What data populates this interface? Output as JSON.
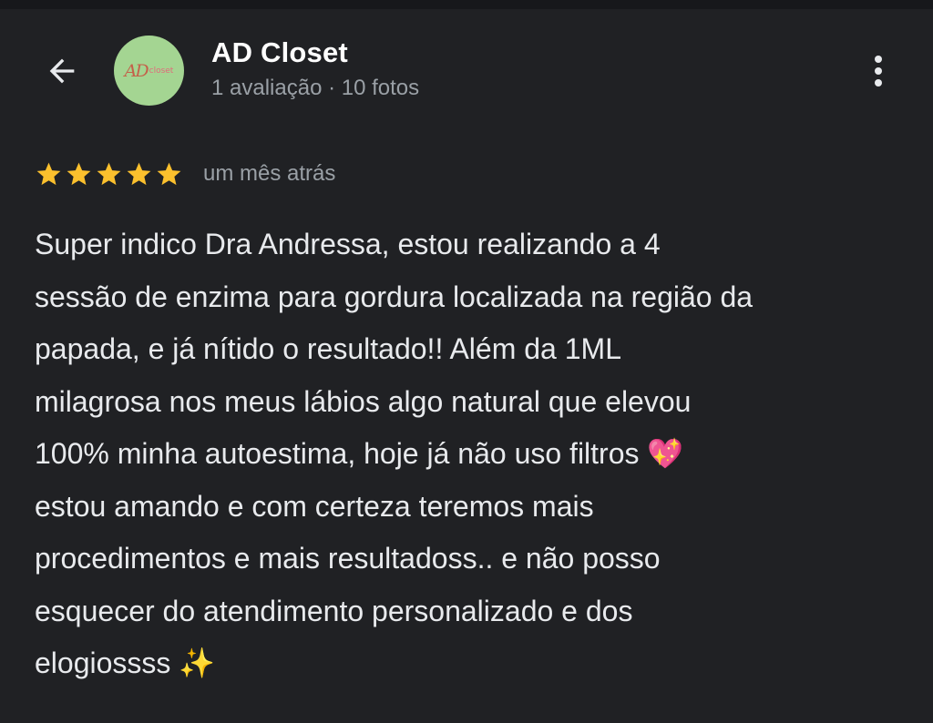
{
  "header": {
    "title": "AD Closet",
    "meta": "1 avaliação · 10 fotos",
    "avatar_logo": {
      "ad": "AD",
      "closet": "closet"
    },
    "back_icon": "arrow-left-icon",
    "menu_icon": "more-vert-icon"
  },
  "review": {
    "rating": 5,
    "rating_max": 5,
    "star_color": "#fbc02d",
    "time": "um mês atrás",
    "text": "Super indico Dra Andressa, estou realizando a 4\nsessão de enzima para gordura localizada na região da\npapada, e já nítido o resultado!! Além da 1ML\nmilagrosa nos meus lábios algo natural que elevou\n100% minha autoestima, hoje já não uso filtros 💖\nestou amando e com certeza teremos mais\nprocedimentos e mais resultadoss.. e não posso\nesquecer do atendimento personalizado e dos\nelogiossss ✨"
  },
  "colors": {
    "background": "#202124",
    "primary_text": "#e8eaed",
    "secondary_text": "#9aa0a6",
    "avatar_bg": "#a4d592"
  }
}
